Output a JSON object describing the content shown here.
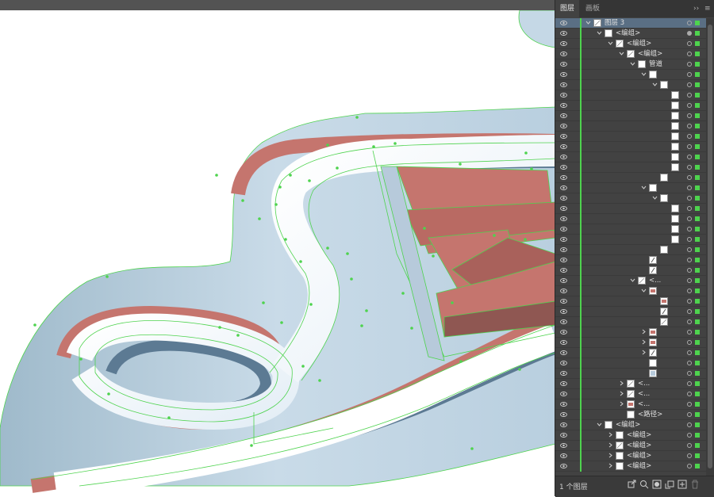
{
  "panel": {
    "tabs": [
      {
        "label": "图层",
        "active": true
      },
      {
        "label": "画板",
        "active": false
      }
    ],
    "expand_glyph": "››",
    "menu_glyph": "≡",
    "footer": {
      "count_label": "1 个图层",
      "icons": [
        "export-icon",
        "search-icon",
        "clip-mask-icon",
        "sublayer-icon",
        "new-layer-icon",
        "delete-icon"
      ]
    },
    "rows": [
      {
        "depth": 0,
        "chevron": "down",
        "label": "图层 3",
        "thumb": "line",
        "selected": true,
        "target": "open"
      },
      {
        "depth": 1,
        "chevron": "down",
        "label": "<编组>",
        "thumb": "blank",
        "target": "filled"
      },
      {
        "depth": 2,
        "chevron": "down",
        "label": "<编组>",
        "thumb": "line",
        "target": "open"
      },
      {
        "depth": 3,
        "chevron": "down",
        "label": "<编组>",
        "thumb": "line",
        "target": "open"
      },
      {
        "depth": 4,
        "chevron": "down",
        "label": "管道",
        "thumb": "blank",
        "target": "open"
      },
      {
        "depth": 5,
        "chevron": "down",
        "label": "",
        "thumb": "blank",
        "target": "open"
      },
      {
        "depth": 6,
        "chevron": "down",
        "label": "",
        "thumb": "blank",
        "target": "open"
      },
      {
        "depth": 7,
        "chevron": "none",
        "label": "",
        "thumb": "blank",
        "target": "open"
      },
      {
        "depth": 7,
        "chevron": "none",
        "label": "",
        "thumb": "blank",
        "target": "open"
      },
      {
        "depth": 7,
        "chevron": "none",
        "label": "",
        "thumb": "blank",
        "target": "open"
      },
      {
        "depth": 7,
        "chevron": "none",
        "label": "",
        "thumb": "blank",
        "target": "open"
      },
      {
        "depth": 7,
        "chevron": "none",
        "label": "",
        "thumb": "blank",
        "target": "open"
      },
      {
        "depth": 7,
        "chevron": "none",
        "label": "",
        "thumb": "blank",
        "target": "open"
      },
      {
        "depth": 7,
        "chevron": "none",
        "label": "",
        "thumb": "blank",
        "target": "open"
      },
      {
        "depth": 7,
        "chevron": "none",
        "label": "",
        "thumb": "blank",
        "target": "open"
      },
      {
        "depth": 6,
        "chevron": "none",
        "label": "",
        "thumb": "blank",
        "target": "open"
      },
      {
        "depth": 5,
        "chevron": "down",
        "label": "",
        "thumb": "blank",
        "target": "open"
      },
      {
        "depth": 6,
        "chevron": "down",
        "label": "",
        "thumb": "blank",
        "target": "open"
      },
      {
        "depth": 7,
        "chevron": "none",
        "label": "",
        "thumb": "blank",
        "target": "open"
      },
      {
        "depth": 7,
        "chevron": "none",
        "label": "",
        "thumb": "blank",
        "target": "open"
      },
      {
        "depth": 7,
        "chevron": "none",
        "label": "",
        "thumb": "blank",
        "target": "open"
      },
      {
        "depth": 7,
        "chevron": "none",
        "label": "",
        "thumb": "blank",
        "target": "open"
      },
      {
        "depth": 6,
        "chevron": "none",
        "label": "",
        "thumb": "blank",
        "target": "open"
      },
      {
        "depth": 5,
        "chevron": "none",
        "label": "",
        "thumb": "slash",
        "target": "open"
      },
      {
        "depth": 5,
        "chevron": "none",
        "label": "",
        "thumb": "slash",
        "target": "open"
      },
      {
        "depth": 4,
        "chevron": "down",
        "label": "<...",
        "thumb": "line",
        "target": "open"
      },
      {
        "depth": 5,
        "chevron": "down",
        "label": "",
        "thumb": "red",
        "target": "open"
      },
      {
        "depth": 6,
        "chevron": "none",
        "label": "",
        "thumb": "red",
        "target": "open"
      },
      {
        "depth": 6,
        "chevron": "none",
        "label": "",
        "thumb": "slash",
        "target": "open"
      },
      {
        "depth": 6,
        "chevron": "none",
        "label": "",
        "thumb": "line",
        "target": "open"
      },
      {
        "depth": 5,
        "chevron": "right",
        "label": "",
        "thumb": "red",
        "target": "open"
      },
      {
        "depth": 5,
        "chevron": "right",
        "label": "",
        "thumb": "red",
        "target": "open"
      },
      {
        "depth": 5,
        "chevron": "right",
        "label": "",
        "thumb": "slash",
        "target": "open"
      },
      {
        "depth": 5,
        "chevron": "none",
        "label": "",
        "thumb": "blank",
        "target": "open"
      },
      {
        "depth": 5,
        "chevron": "none",
        "label": "",
        "thumb": "blue",
        "target": "open"
      },
      {
        "depth": 3,
        "chevron": "right",
        "label": "<...",
        "thumb": "line",
        "target": "open"
      },
      {
        "depth": 3,
        "chevron": "right",
        "label": "<...",
        "thumb": "line",
        "target": "open"
      },
      {
        "depth": 3,
        "chevron": "right",
        "label": "<...",
        "thumb": "red",
        "target": "open"
      },
      {
        "depth": 3,
        "chevron": "none",
        "label": "<路径>",
        "thumb": "blank",
        "target": "open"
      },
      {
        "depth": 1,
        "chevron": "down",
        "label": "<编组>",
        "thumb": "blank",
        "target": "open"
      },
      {
        "depth": 2,
        "chevron": "right",
        "label": "<编组>",
        "thumb": "blank",
        "target": "open"
      },
      {
        "depth": 2,
        "chevron": "right",
        "label": "<编组>",
        "thumb": "line",
        "target": "open"
      },
      {
        "depth": 2,
        "chevron": "right",
        "label": "<编组>",
        "thumb": "blank",
        "target": "open"
      },
      {
        "depth": 2,
        "chevron": "right",
        "label": "<编组>",
        "thumb": "blank",
        "target": "open"
      }
    ]
  },
  "colors": {
    "panel_bg": "#424242",
    "selection_row": "#5a6f84",
    "layer_color": "#4ed34e",
    "track_red": "#c5756e",
    "track_navy": "#5c7a93",
    "track_lightblue": "#c5d8e6",
    "path_outline": "#4ed34e"
  }
}
